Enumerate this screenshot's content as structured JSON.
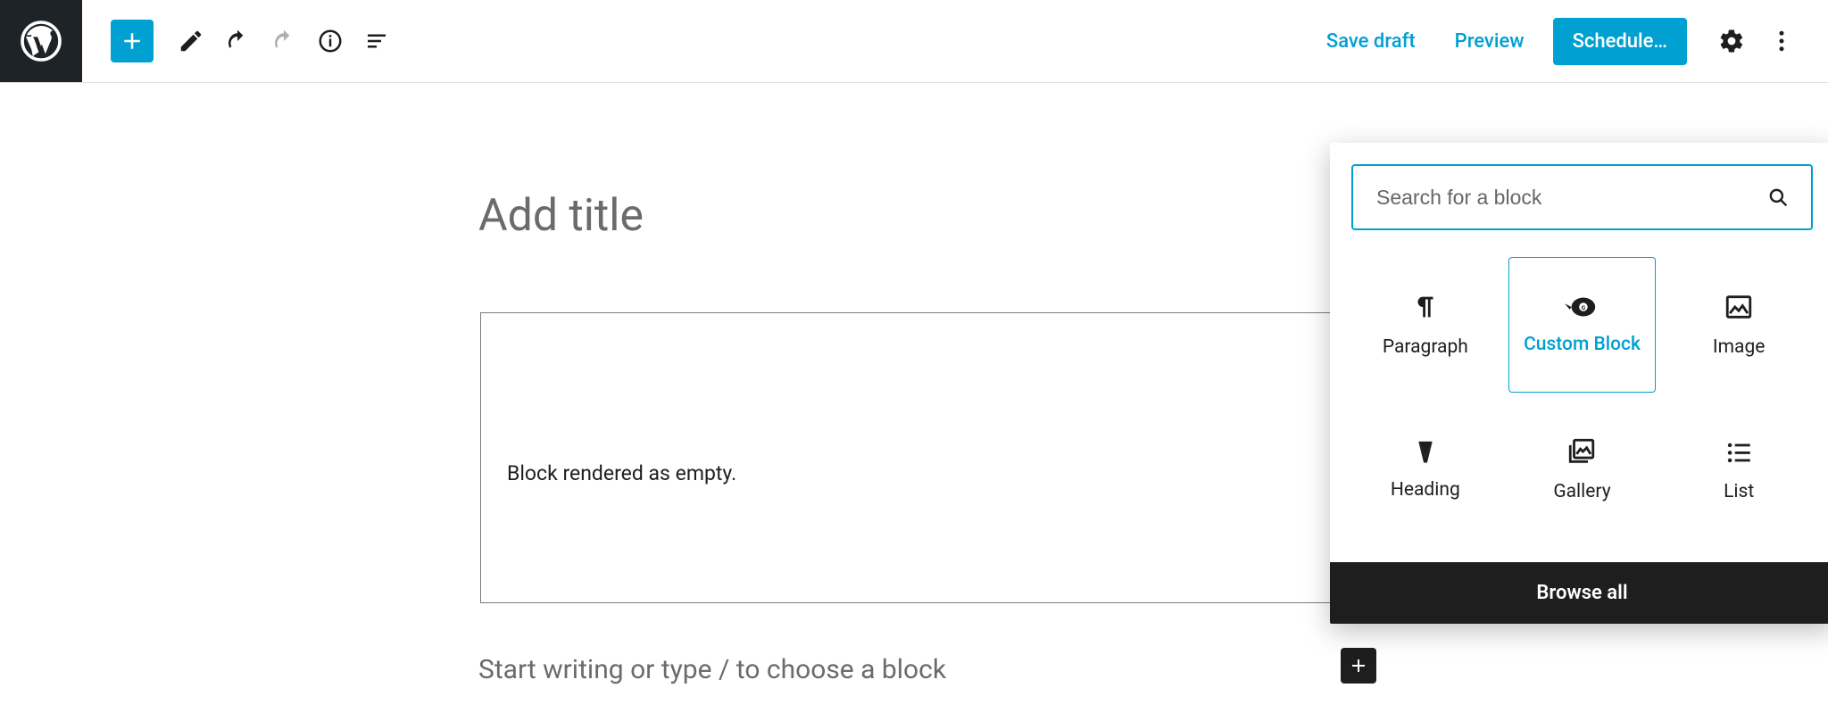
{
  "header": {
    "save_draft": "Save draft",
    "preview": "Preview",
    "schedule": "Schedule…"
  },
  "toolbar_icons": {
    "inserter": "add-block",
    "edit": "edit",
    "undo": "undo",
    "redo": "redo",
    "info": "info",
    "outline": "list-view",
    "settings": "settings",
    "more": "more"
  },
  "canvas": {
    "title_placeholder": "Add title",
    "empty_block_message": "Block rendered as empty.",
    "writing_prompt": "Start writing or type / to choose a block"
  },
  "picker": {
    "search_placeholder": "Search for a block",
    "browse_all": "Browse all",
    "blocks": [
      {
        "label": "Paragraph",
        "icon": "paragraph",
        "selected": false
      },
      {
        "label": "Custom Block",
        "icon": "custom-block",
        "selected": true
      },
      {
        "label": "Image",
        "icon": "image",
        "selected": false
      },
      {
        "label": "Heading",
        "icon": "heading",
        "selected": false
      },
      {
        "label": "Gallery",
        "icon": "gallery",
        "selected": false
      },
      {
        "label": "List",
        "icon": "list",
        "selected": false
      }
    ]
  },
  "colors": {
    "accent": "#00a0d2",
    "admin_bg": "#1d2327"
  }
}
